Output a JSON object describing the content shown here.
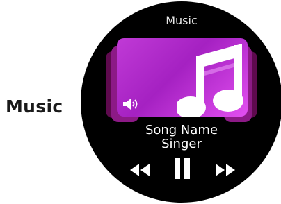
{
  "side_label": "Music",
  "watch": {
    "title": "Music",
    "song_name": "Song Name",
    "singer": "Singer",
    "icons": {
      "album_art": "music-note-icon",
      "volume": "speaker-icon",
      "previous": "rewind-icon",
      "pause": "pause-icon",
      "next": "fast-forward-icon"
    },
    "colors": {
      "album_gradient_start": "#c03ad6",
      "album_gradient_end": "#e24ff0",
      "background": "#000000",
      "text": "#ffffff"
    }
  }
}
